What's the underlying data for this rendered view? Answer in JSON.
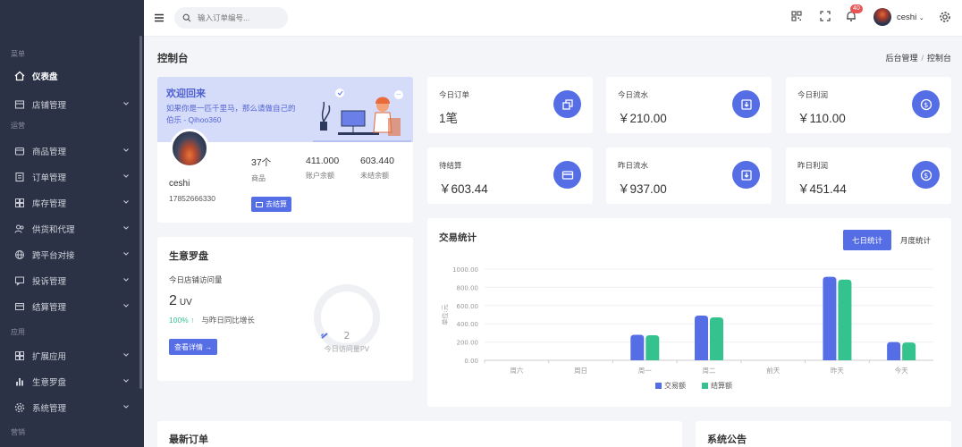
{
  "sidebar": {
    "groups": [
      {
        "label": "菜单",
        "items": [
          {
            "label": "仪表盘",
            "icon": "home-icon",
            "active": true
          },
          {
            "label": "店铺管理",
            "icon": "store-icon"
          }
        ]
      },
      {
        "label": "运营",
        "items": [
          {
            "label": "商品管理",
            "icon": "goods-icon"
          },
          {
            "label": "订单管理",
            "icon": "order-icon"
          },
          {
            "label": "库存管理",
            "icon": "inventory-icon"
          },
          {
            "label": "供货和代理",
            "icon": "supplier-icon"
          },
          {
            "label": "跨平台对接",
            "icon": "globe-icon"
          },
          {
            "label": "投诉管理",
            "icon": "complaint-icon"
          },
          {
            "label": "结算管理",
            "icon": "card-icon"
          }
        ]
      },
      {
        "label": "应用",
        "items": [
          {
            "label": "扩展应用",
            "icon": "apps-icon"
          },
          {
            "label": "生意罗盘",
            "icon": "bar-chart-icon"
          },
          {
            "label": "系统管理",
            "icon": "gear-icon"
          }
        ]
      },
      {
        "label": "营销",
        "items": []
      }
    ]
  },
  "topbar": {
    "search_placeholder": "输入订单编号...",
    "notification_count": "40",
    "username": "ceshi"
  },
  "header": {
    "title": "控制台",
    "breadcrumb": [
      "后台管理",
      "控制台"
    ]
  },
  "welcome": {
    "title": "欢迎回来",
    "subtitle": "如果你是一匹千里马，那么请做自己的伯乐 - Qihoo360",
    "name": "ceshi",
    "phone": "17852666330",
    "stats": [
      {
        "value": "37个",
        "label": "商品"
      },
      {
        "value": "411.000",
        "label": "账户余额"
      },
      {
        "value": "603.440",
        "label": "未结余额"
      }
    ],
    "button": "去结算"
  },
  "stat_cards": [
    {
      "title": "今日订单",
      "value": "1笔",
      "icon": "copy-icon"
    },
    {
      "title": "今日流水",
      "value": "￥210.00",
      "icon": "download-box-icon"
    },
    {
      "title": "今日利润",
      "value": "￥110.00",
      "icon": "dollar-circle-icon"
    },
    {
      "title": "待结算",
      "value": "￥603.44",
      "icon": "credit-card-icon"
    },
    {
      "title": "昨日流水",
      "value": "￥937.00",
      "icon": "download-box-icon"
    },
    {
      "title": "昨日利润",
      "value": "￥451.44",
      "icon": "dollar-circle-icon"
    }
  ],
  "compass": {
    "title": "生意罗盘",
    "uv_label": "今日店铺访问量",
    "uv_value": "2",
    "uv_unit": "UV",
    "growth_pct": "100% ↑",
    "growth_label": "与昨日同比增长",
    "button": "查看详情 →",
    "pv_value": "2",
    "pv_label": "今日访问量PV"
  },
  "transactions": {
    "title": "交易统计",
    "tabs": [
      "七日统计",
      "月度统计"
    ],
    "active_tab": 0
  },
  "chart_data": {
    "type": "bar",
    "ylabel": "单位:元",
    "ylim": [
      0,
      1000
    ],
    "yticks": [
      "0.00",
      "200.00",
      "400.00",
      "600.00",
      "800.00",
      "1000.00"
    ],
    "categories": [
      "周六",
      "周日",
      "周一",
      "周二",
      "前天",
      "昨天",
      "今天"
    ],
    "series": [
      {
        "name": "交易额",
        "color": "#556ee6",
        "values": [
          0,
          0,
          280,
          490,
          0,
          915,
          200
        ]
      },
      {
        "name": "结算额",
        "color": "#34c38f",
        "values": [
          0,
          0,
          275,
          470,
          0,
          885,
          195
        ]
      }
    ],
    "legend": "bottom-center"
  },
  "bottom": {
    "orders_title": "最新订单",
    "notice_title": "系统公告"
  }
}
